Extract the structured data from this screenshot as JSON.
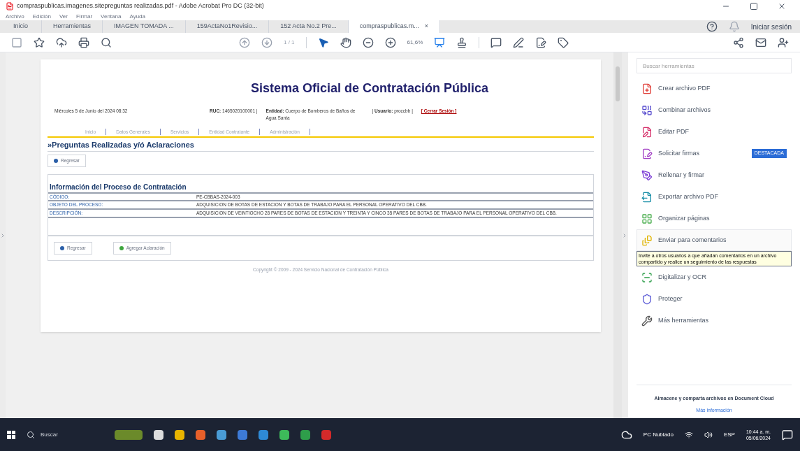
{
  "window": {
    "title": "compraspublicas.imagenes.sitepreguntas realizadas.pdf - Adobe Acrobat Pro DC (32-bit)"
  },
  "menu": [
    "Archivo",
    "Edición",
    "Ver",
    "Firmar",
    "Ventana",
    "Ayuda"
  ],
  "tabs": [
    {
      "label": "Inicio",
      "selected": false
    },
    {
      "label": "Herramientas",
      "selected": false
    },
    {
      "label": "IMAGEN TOMADA ...",
      "selected": false
    },
    {
      "label": "159ActaNo1Revisio...",
      "selected": false
    },
    {
      "label": "152 Acta No.2 Pre...",
      "selected": false
    },
    {
      "label": "compraspublicas.m...",
      "selected": true,
      "close": "×"
    }
  ],
  "account": {
    "sign_in": "Iniciar sesión"
  },
  "toolbar": {
    "page": "1 / 1",
    "zoom": "61,6%"
  },
  "document": {
    "title": "Sistema Oficial de Contratación Pública",
    "date": "Miércoles 5 de Junio del 2024 08:32",
    "ruc": "**RUC:** 1465020100001 |",
    "entity": "**Entidad:** Cuerpo de Bomberos de Baños de Agua Santa",
    "user": "| **Usuario:** proccbb |",
    "logout": "[ Cerrar Sesión ]",
    "nav": [
      "Inicio",
      "Datos Generales",
      "Servicios",
      "Entidad Contratante",
      "Administración"
    ],
    "heading": "»Preguntas Realizadas y/ó Aclaraciones",
    "back_top": "Regresar",
    "table_title": "Información del Proceso de Contratación",
    "rows": [
      {
        "label": "CÓDIGO:",
        "value": "PE-CBBAS-2024-003"
      },
      {
        "label": "OBJETO DEL PROCESO:",
        "value": "ADQUISICION DE BOTAS DE ESTACION Y BOTAS DE TRABAJO PARA EL PERSONAL OPERATIVO DEL CBB."
      },
      {
        "label": "DESCRIPCIÓN:",
        "value": "ADQUISICION DE VEINTIOCHO 28 PARES DE BOTAS DE ESTACION Y TREINTA Y CINCO 35 PARES DE BOTAS DE TRABAJO PARA EL PERSONAL OPERATIVO DEL CBB."
      }
    ],
    "buttons": [
      "Regresar",
      "Agregar Aclaración"
    ],
    "copyright": "Copyright © 2009 - 2024 Servicio Nacional de Contratación Pública"
  },
  "tools_panel": {
    "search": {
      "placeholder": "Buscar herramientas"
    },
    "tools": [
      {
        "label": "Crear archivo PDF",
        "highlighted": false
      },
      {
        "label": "Combinar archivos",
        "highlighted": false
      },
      {
        "label": "Editar PDF",
        "highlighted": false
      },
      {
        "label": "Solicitar firmas",
        "highlighted": false,
        "badge": "DESTACADA"
      },
      {
        "label": "Rellenar y firmar",
        "highlighted": false
      },
      {
        "label": "Exportar archivo PDF",
        "highlighted": false
      },
      {
        "label": "Organizar páginas",
        "highlighted": false
      },
      {
        "label": "Enviar para comentarios",
        "highlighted": true,
        "tooltip": "Invite a otros usuarios a que añadan comentarios en un archivo compartido y realice un seguimiento de las respuestas"
      },
      {
        "label": "Digitalizar y OCR",
        "highlighted": false
      },
      {
        "label": "Proteger",
        "highlighted": false
      },
      {
        "label": "Más herramientas",
        "highlighted": false
      }
    ],
    "cloud_text": "Almacene y comparta archivos en Document Cloud",
    "more_info": "Más información"
  },
  "taskbar": {
    "search": "Buscar",
    "weather": "PC Nublado",
    "language": "ESP",
    "time": "10:44 a. m.",
    "date": "05/06/2024"
  }
}
